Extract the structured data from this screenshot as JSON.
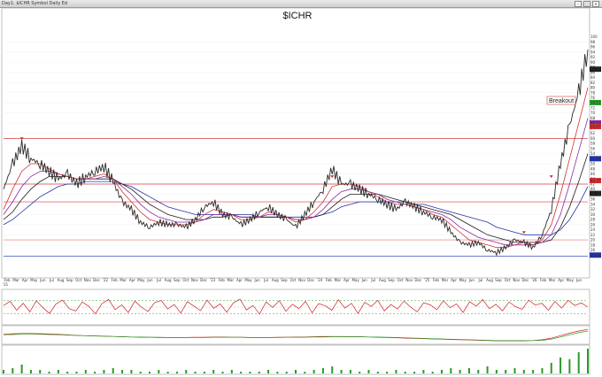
{
  "window": {
    "title": "Day1: $ICHR Symbol Daily Ed"
  },
  "chart_data": {
    "type": "line",
    "title": "$ICHR",
    "price_scale": {
      "ylim": [
        12,
        110
      ],
      "ticks": [
        14,
        16,
        18,
        20,
        22,
        24,
        26,
        28,
        30,
        32,
        34,
        36,
        38,
        40,
        42,
        44,
        46,
        48,
        50,
        52,
        54,
        56,
        58,
        60,
        62,
        64,
        66,
        68,
        70,
        72,
        74,
        76,
        78,
        80,
        82,
        84,
        86,
        88,
        90,
        92,
        94,
        96,
        98,
        100
      ]
    },
    "x_axis": {
      "months": [
        "Feb",
        "Mar",
        "Apr",
        "May",
        "Jun",
        "Jul",
        "Aug",
        "Sep",
        "Oct",
        "Nov",
        "Dec",
        "'22",
        "Feb",
        "Mar",
        "Apr",
        "May",
        "Jun",
        "Jul",
        "Aug",
        "Sep",
        "Oct",
        "Nov",
        "Dec",
        "'23",
        "Feb",
        "Mar",
        "Apr",
        "May",
        "Jun",
        "Jul",
        "Aug",
        "Sep",
        "Oct",
        "Nov",
        "Dec",
        "'24",
        "Feb",
        "Mar",
        "Apr",
        "May",
        "Jun",
        "Jul",
        "Aug",
        "Sep",
        "Oct",
        "Nov",
        "Dec",
        "'25",
        "Feb",
        "Mar",
        "Apr",
        "May",
        "Jun",
        "Jul",
        "Aug",
        "Sep",
        "Oct",
        "Nov",
        "Dec",
        "'26",
        "Feb",
        "Mar",
        "Apr",
        "May",
        "Jun"
      ],
      "start_label": "'21"
    },
    "series": [
      {
        "kind": "price",
        "color": "#2a2a2a",
        "values": [
          40,
          50,
          57,
          52,
          50,
          47,
          44,
          46,
          42,
          45,
          47,
          49,
          43,
          35,
          32,
          27,
          25,
          27,
          26,
          26,
          25,
          28,
          33,
          35,
          30,
          29,
          26,
          28,
          31,
          33,
          30,
          28,
          25,
          30,
          35,
          40,
          48,
          42,
          42,
          40,
          38,
          36,
          34,
          32,
          35,
          33,
          31,
          29,
          28,
          23,
          19,
          18,
          19,
          16,
          15,
          17,
          20,
          19,
          17,
          22,
          32,
          50,
          65,
          78,
          95
        ]
      },
      {
        "kind": "ma",
        "color": "#d03030",
        "values": [
          32,
          40,
          47,
          50,
          50,
          48,
          46,
          45,
          44,
          44,
          45,
          46,
          44,
          39,
          35,
          31,
          28,
          27,
          26,
          26,
          26,
          27,
          30,
          32,
          31,
          30,
          28,
          28,
          29,
          31,
          30,
          29,
          27,
          28,
          31,
          35,
          41,
          42,
          42,
          41,
          39,
          37,
          35,
          34,
          34,
          33,
          32,
          30,
          29,
          26,
          23,
          20,
          19,
          18,
          17,
          17,
          18,
          19,
          18,
          20,
          26,
          38,
          52,
          66,
          80
        ]
      },
      {
        "kind": "ma",
        "color": "#8a2aa0",
        "values": [
          30,
          35,
          41,
          45,
          47,
          47,
          46,
          45,
          44,
          44,
          44,
          45,
          44,
          41,
          38,
          34,
          31,
          29,
          28,
          27,
          27,
          27,
          28,
          30,
          30,
          30,
          29,
          29,
          29,
          30,
          30,
          29,
          28,
          28,
          29,
          32,
          36,
          39,
          40,
          40,
          39,
          38,
          36,
          35,
          34,
          33,
          32,
          31,
          30,
          28,
          25,
          23,
          21,
          20,
          19,
          18,
          18,
          18,
          18,
          19,
          22,
          30,
          42,
          55,
          68
        ]
      },
      {
        "kind": "ma",
        "color": "#1c1c1c",
        "values": [
          28,
          31,
          36,
          40,
          43,
          45,
          45,
          45,
          44,
          44,
          44,
          44,
          44,
          42,
          40,
          37,
          34,
          32,
          30,
          29,
          28,
          28,
          28,
          29,
          29,
          30,
          29,
          29,
          29,
          29,
          29,
          29,
          28,
          28,
          29,
          30,
          33,
          36,
          38,
          38,
          38,
          38,
          37,
          36,
          35,
          34,
          33,
          32,
          31,
          30,
          28,
          26,
          24,
          22,
          21,
          20,
          19,
          19,
          19,
          19,
          20,
          25,
          33,
          43,
          54
        ]
      },
      {
        "kind": "ma",
        "color": "#2233aa",
        "values": [
          26,
          28,
          31,
          34,
          37,
          39,
          41,
          42,
          42,
          43,
          43,
          43,
          43,
          42,
          41,
          39,
          37,
          35,
          33,
          32,
          31,
          30,
          30,
          30,
          30,
          30,
          30,
          30,
          29,
          29,
          29,
          29,
          29,
          29,
          29,
          30,
          31,
          33,
          34,
          35,
          35,
          35,
          35,
          35,
          35,
          34,
          34,
          33,
          32,
          31,
          30,
          29,
          28,
          27,
          25,
          24,
          23,
          22,
          22,
          22,
          22,
          24,
          28,
          34,
          41
        ]
      }
    ],
    "horizontal_lines": [
      {
        "y": 60,
        "color": "#d04040"
      },
      {
        "y": 42,
        "color": "#d04040"
      },
      {
        "y": 35,
        "color": "#d04040"
      },
      {
        "y": 20,
        "color": "#e07070"
      },
      {
        "y": 13.5,
        "color": "#2233aa"
      }
    ],
    "markers": [
      {
        "x_index": 2,
        "y": 58
      },
      {
        "x_index": 36,
        "y": 43
      },
      {
        "x_index": 57,
        "y": 21
      },
      {
        "x_index": 60,
        "y": 43
      }
    ],
    "annotations": [
      {
        "text": "Breakout"
      }
    ],
    "last_value_badges": [
      {
        "value": "87.27",
        "color": "#1c1c1c"
      },
      {
        "value": "74.11",
        "color": "#2a9a2a"
      },
      {
        "value": "66.11",
        "color": "#8a2aa0"
      },
      {
        "value": "64.67",
        "color": "#d03030"
      },
      {
        "value": "51.99",
        "color": "#2233aa"
      },
      {
        "value": "43.37",
        "color": "#d03030"
      },
      {
        "value": "38.30",
        "color": "#1c1c1c"
      },
      {
        "value": "14.00",
        "color": "#2233aa"
      }
    ],
    "rsi": {
      "ylim": [
        0,
        100
      ],
      "levels": [
        70,
        50,
        30
      ],
      "color": "#d02020",
      "values": [
        55,
        68,
        40,
        62,
        35,
        70,
        48,
        30,
        60,
        72,
        45,
        38,
        66,
        52,
        29,
        61,
        74,
        42,
        57,
        33,
        69,
        50,
        36,
        64,
        71,
        44,
        58,
        31,
        67,
        53,
        39,
        72,
        46,
        60,
        34,
        63,
        75,
        41,
        55,
        28,
        66,
        49,
        70,
        37,
        59,
        45,
        68,
        32,
        61,
        54,
        40,
        73,
        47,
        62,
        30,
        65,
        52,
        71,
        38,
        58,
        44,
        69,
        50,
        35,
        64,
        57,
        42,
        70,
        48,
        60,
        33,
        67,
        53,
        74,
        45,
        59,
        38,
        66,
        51,
        43,
        72,
        56,
        62,
        40,
        68,
        47,
        71,
        55,
        63,
        50
      ]
    },
    "lower_panel": {
      "series": [
        {
          "color": "#d02020",
          "values": [
            60,
            62,
            63,
            63,
            62,
            61,
            60,
            58,
            56,
            55,
            54,
            53,
            52,
            51,
            50,
            49,
            49,
            48,
            48,
            48,
            48,
            49,
            49,
            50,
            50,
            49,
            49,
            48,
            48,
            48,
            49,
            49,
            50,
            50,
            51,
            52,
            52,
            52,
            51,
            51,
            50,
            49,
            48,
            47,
            46,
            45,
            44,
            43,
            42,
            41,
            40,
            39,
            38,
            37,
            36,
            36,
            36,
            36,
            37,
            40,
            46,
            55,
            64,
            72,
            78
          ]
        },
        {
          "color": "#2a9a2a",
          "values": [
            58,
            59,
            60,
            60,
            60,
            59,
            58,
            57,
            56,
            55,
            54,
            53,
            52,
            51,
            50,
            50,
            49,
            49,
            48,
            48,
            48,
            48,
            48,
            49,
            49,
            49,
            49,
            48,
            48,
            48,
            48,
            49,
            49,
            49,
            50,
            50,
            51,
            51,
            51,
            51,
            50,
            50,
            49,
            48,
            47,
            46,
            45,
            44,
            43,
            42,
            41,
            40,
            39,
            38,
            37,
            37,
            37,
            37,
            37,
            38,
            42,
            50,
            58,
            66,
            72
          ]
        }
      ]
    },
    "volume": {
      "color": "#2a9a2a",
      "values": [
        2,
        3,
        5,
        2,
        2,
        1,
        2,
        1,
        1,
        2,
        1,
        2,
        3,
        2,
        2,
        1,
        1,
        2,
        1,
        1,
        2,
        1,
        1,
        2,
        1,
        2,
        1,
        1,
        1,
        2,
        1,
        1,
        2,
        1,
        2,
        3,
        4,
        2,
        2,
        1,
        2,
        1,
        1,
        2,
        1,
        1,
        2,
        1,
        2,
        3,
        2,
        3,
        2,
        4,
        2,
        2,
        3,
        2,
        2,
        3,
        6,
        9,
        8,
        12,
        14
      ]
    }
  }
}
